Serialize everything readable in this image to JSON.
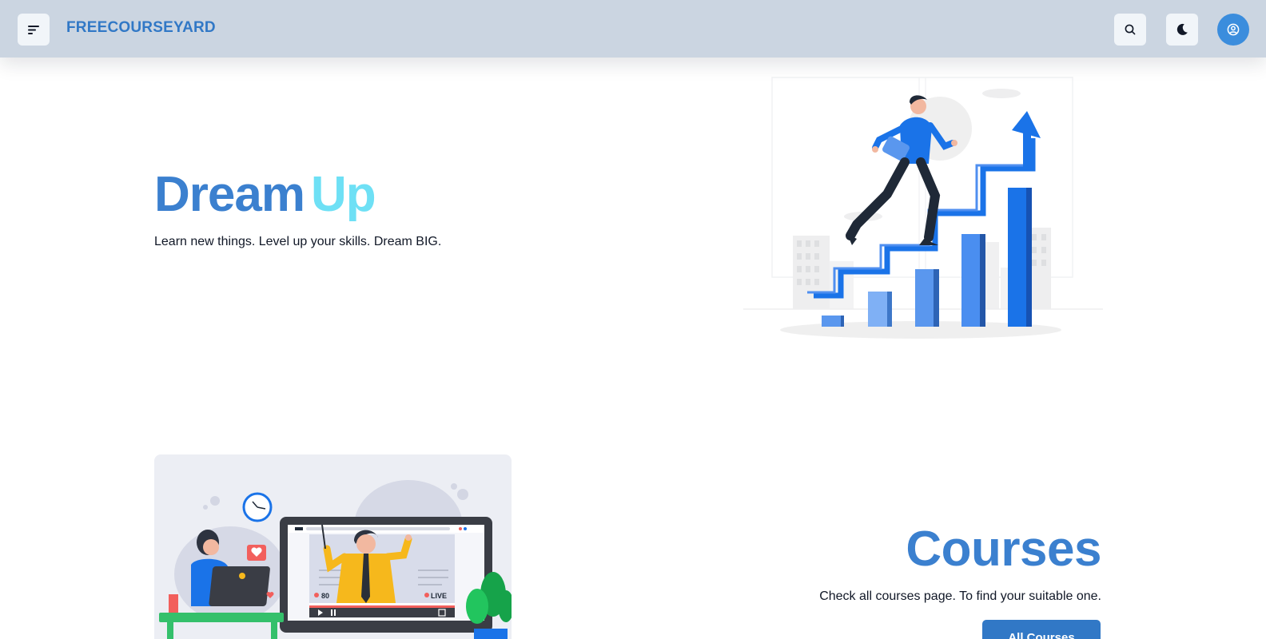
{
  "navbar": {
    "brand": "FREECOURSEYARD",
    "icons": {
      "menu": "menu-icon",
      "search": "search-icon",
      "theme": "moon-icon",
      "account": "user-circle-icon"
    }
  },
  "hero": {
    "title_word1": "Dream",
    "title_word2": "Up",
    "subtitle": "Learn new things. Level up your skills. Dream BIG."
  },
  "courses": {
    "title": "Courses",
    "subtitle": "Check all courses page. To find your suitable one.",
    "button_label": "All Courses",
    "illustration": {
      "viewer_count": "80",
      "live_label": "LIVE"
    }
  },
  "colors": {
    "navbar_bg": "#cbd5e1",
    "brand": "#3178c6",
    "title_blue": "#3b80cf",
    "title_cyan": "#6ee0f5",
    "accent_blue": "#1a73e8",
    "button_bg": "#3178c6"
  }
}
